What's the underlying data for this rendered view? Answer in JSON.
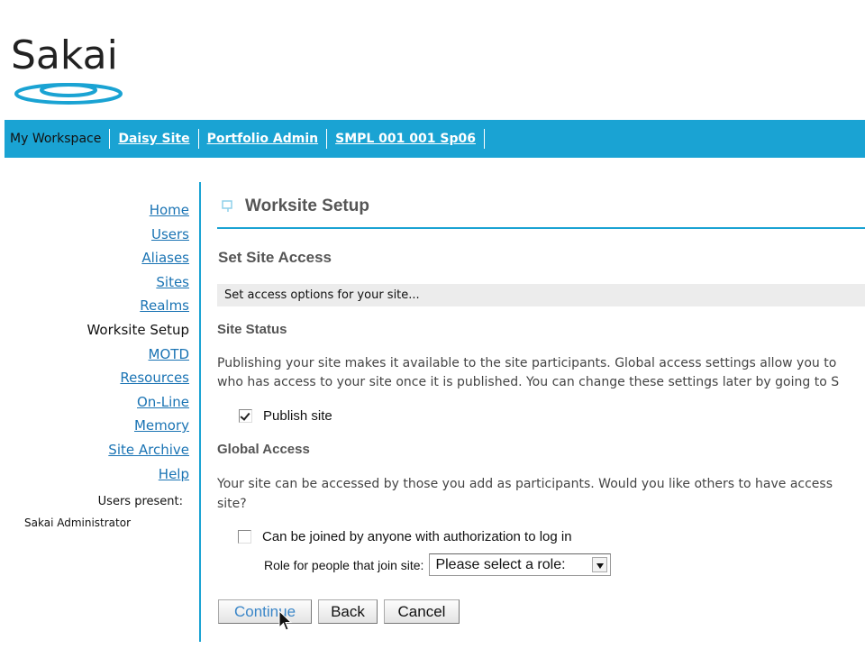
{
  "logo": {
    "text": "Sakai"
  },
  "topnav": {
    "tabs": [
      {
        "label": "My Workspace",
        "current": true
      },
      {
        "label": "Daisy Site",
        "current": false
      },
      {
        "label": "Portfolio Admin",
        "current": false
      },
      {
        "label": "SMPL 001 001 Sp06",
        "current": false
      }
    ],
    "bar_color": "#1aa3d3"
  },
  "toolmenu": {
    "items": [
      {
        "label": "Home"
      },
      {
        "label": "Users"
      },
      {
        "label": "Aliases"
      },
      {
        "label": "Sites"
      },
      {
        "label": "Realms"
      },
      {
        "label": "Worksite Setup"
      },
      {
        "label": "MOTD"
      },
      {
        "label": "Resources"
      },
      {
        "label": "On-Line"
      },
      {
        "label": "Memory"
      },
      {
        "label": "Site Archive"
      },
      {
        "label": "Help"
      }
    ],
    "current_index": 5,
    "users_present_label": "Users present:",
    "users_present_name": "Sakai Administrator"
  },
  "main": {
    "title": "Worksite Setup",
    "section_heading": "Set Site Access",
    "instruction": "Set access options for your site...",
    "site_status": {
      "heading": "Site Status",
      "description_line1": "Publishing your site makes it available to the site participants. Global access settings allow you to",
      "description_line2": "who has access to your site once it is published. You can change these settings later by going to S",
      "publish_label": "Publish site",
      "publish_checked": true
    },
    "global_access": {
      "heading": "Global Access",
      "description_line1": "Your site can be accessed by those you add as participants. Would you like others to have access",
      "description_line2": "site?",
      "join_label": "Can be joined by anyone with authorization to log in",
      "join_checked": false,
      "role_label": "Role for people that join site:",
      "role_selected": "Please select a role:"
    },
    "buttons": {
      "continue": "Continue",
      "back": "Back",
      "cancel": "Cancel"
    }
  },
  "colors": {
    "accent": "#1aa3d3",
    "link": "#1b74b4"
  }
}
